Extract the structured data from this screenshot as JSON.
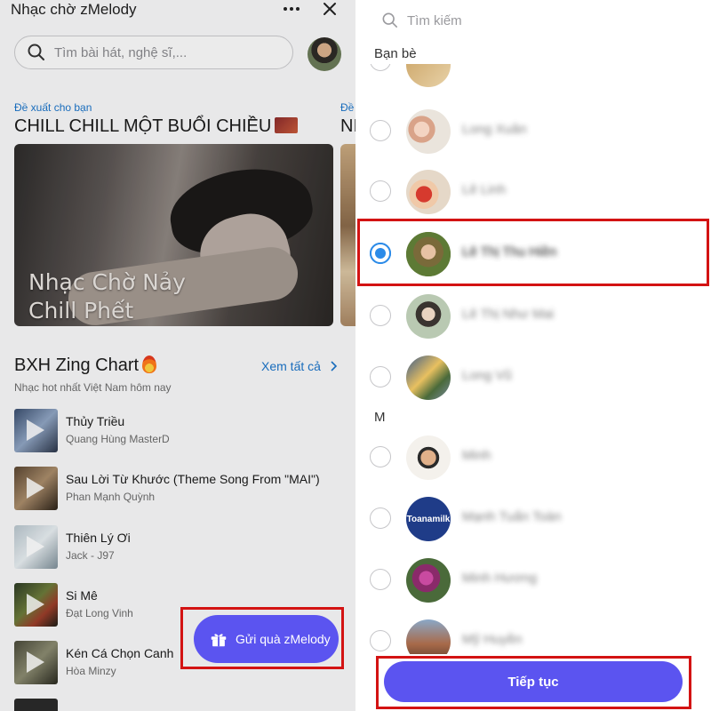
{
  "left": {
    "app_title": "Nhạc chờ zMelody",
    "search_placeholder": "Tìm bài hát, nghệ sĩ,...",
    "suggest_label": "Đề xuất cho bạn",
    "suggest_label_2": "Đề",
    "playlist_title": "CHILL CHILL MỘT BUỔI CHIỀU",
    "playlist_title_2": "NI",
    "banner_line1": "Nhạc Chờ Nảy",
    "banner_line2": "Chill Phết",
    "chart_title": "BXH Zing Chart",
    "chart_subtitle": "Nhạc hot nhất Việt Nam hôm nay",
    "see_all": "Xem tất cả",
    "songs": [
      {
        "title": "Thủy Triều",
        "artist": "Quang Hùng MasterD"
      },
      {
        "title": "Sau Lời Từ Khước (Theme Song From \"MAI\")",
        "artist": "Phan Mạnh Quỳnh"
      },
      {
        "title": "Thiên Lý Ơi",
        "artist": "Jack - J97"
      },
      {
        "title": "Si Mê",
        "artist": "Đạt Long Vinh"
      },
      {
        "title": "Kén Cá Chọn Canh",
        "artist": "Hòa Minzy"
      }
    ],
    "gift_button": "Gửi quà zMelody"
  },
  "right": {
    "search_placeholder": "Tìm kiếm",
    "section_friends": "Bạn bè",
    "section_m": "M",
    "friends": [
      {
        "name": "Long Xuân",
        "selected": false
      },
      {
        "name": "Lê Linh",
        "selected": false
      },
      {
        "name": "Lê Thị Thu Hiền",
        "selected": true
      },
      {
        "name": "Lê Thị Như Mai",
        "selected": false
      },
      {
        "name": "Long Vũ",
        "selected": false
      },
      {
        "name": "Minh",
        "selected": false
      },
      {
        "name": "Mạnh Tuấn Toàn",
        "selected": false,
        "avatar_text": "Toanamilk"
      },
      {
        "name": "Minh Hương",
        "selected": false
      },
      {
        "name": "Mỹ Huyền",
        "selected": false
      }
    ],
    "continue_button": "Tiếp tục"
  },
  "colors": {
    "accent": "#5b54f0",
    "link": "#1a73c8",
    "radio_selected": "#2c8be8",
    "highlight_frame": "#d31313"
  }
}
